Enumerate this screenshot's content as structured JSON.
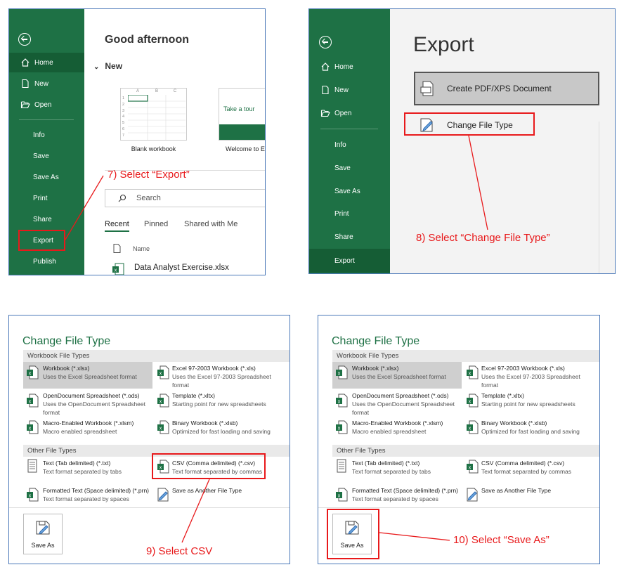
{
  "colors": {
    "excel_green": "#1e7145",
    "annotation_red": "#e8191b"
  },
  "panel1": {
    "sidebar": [
      {
        "label": "Home",
        "icon": "home-icon"
      },
      {
        "label": "New",
        "icon": "new-doc-icon"
      },
      {
        "label": "Open",
        "icon": "folder-open-icon"
      },
      {
        "label": "Info"
      },
      {
        "label": "Save"
      },
      {
        "label": "Save As"
      },
      {
        "label": "Print"
      },
      {
        "label": "Share"
      },
      {
        "label": "Export"
      },
      {
        "label": "Publish"
      }
    ],
    "greeting": "Good afternoon",
    "new_header": "New",
    "templates": [
      {
        "label": "Blank workbook"
      },
      {
        "label": "Welcome to E",
        "tour_text": "Take a tour"
      }
    ],
    "grid_cols": [
      "A",
      "B",
      "C"
    ],
    "grid_rows": [
      "1",
      "2",
      "3",
      "4",
      "5",
      "6",
      "7"
    ],
    "search_placeholder": "Search",
    "tabs": [
      "Recent",
      "Pinned",
      "Shared with Me"
    ],
    "name_header": "Name",
    "recent_file": "Data Analyst Exercise.xlsx",
    "annotation": "7) Select “Export”"
  },
  "panel2": {
    "sidebar": [
      {
        "label": "Home",
        "icon": "home-icon"
      },
      {
        "label": "New",
        "icon": "new-doc-icon"
      },
      {
        "label": "Open",
        "icon": "folder-open-icon"
      },
      {
        "label": "Info"
      },
      {
        "label": "Save"
      },
      {
        "label": "Save As"
      },
      {
        "label": "Print"
      },
      {
        "label": "Share"
      },
      {
        "label": "Export"
      }
    ],
    "title": "Export",
    "option1": "Create PDF/XPS Document",
    "option2": "Change File Type",
    "annotation": "8) Select “Change File Type”"
  },
  "change_file_type": {
    "title": "Change File Type",
    "workbook_header": "Workbook File Types",
    "other_header": "Other File Types",
    "workbook_types": [
      {
        "name": "Workbook (*.xlsx)",
        "desc": "Uses the Excel Spreadsheet format"
      },
      {
        "name": "Excel 97-2003 Workbook (*.xls)",
        "desc": "Uses the Excel 97-2003 Spreadsheet format"
      },
      {
        "name": "OpenDocument Spreadsheet (*.ods)",
        "desc": "Uses the OpenDocument Spreadsheet format"
      },
      {
        "name": "Template (*.xltx)",
        "desc": "Starting point for new spreadsheets"
      },
      {
        "name": "Macro-Enabled Workbook (*.xlsm)",
        "desc": "Macro enabled spreadsheet"
      },
      {
        "name": "Binary Workbook (*.xlsb)",
        "desc": "Optimized for fast loading and saving"
      }
    ],
    "other_types": [
      {
        "name": "Text (Tab delimited) (*.txt)",
        "desc": "Text format separated by tabs"
      },
      {
        "name": "CSV (Comma delimited) (*.csv)",
        "desc": "Text format separated by commas"
      },
      {
        "name": "Formatted Text (Space delimited) (*.prn)",
        "desc": "Text format separated by spaces"
      },
      {
        "name": "Save as Another File Type",
        "desc": ""
      }
    ],
    "save_as_label": "Save As"
  },
  "panel3": {
    "annotation": "9) Select CSV"
  },
  "panel4": {
    "annotation": "10) Select “Save As”"
  }
}
